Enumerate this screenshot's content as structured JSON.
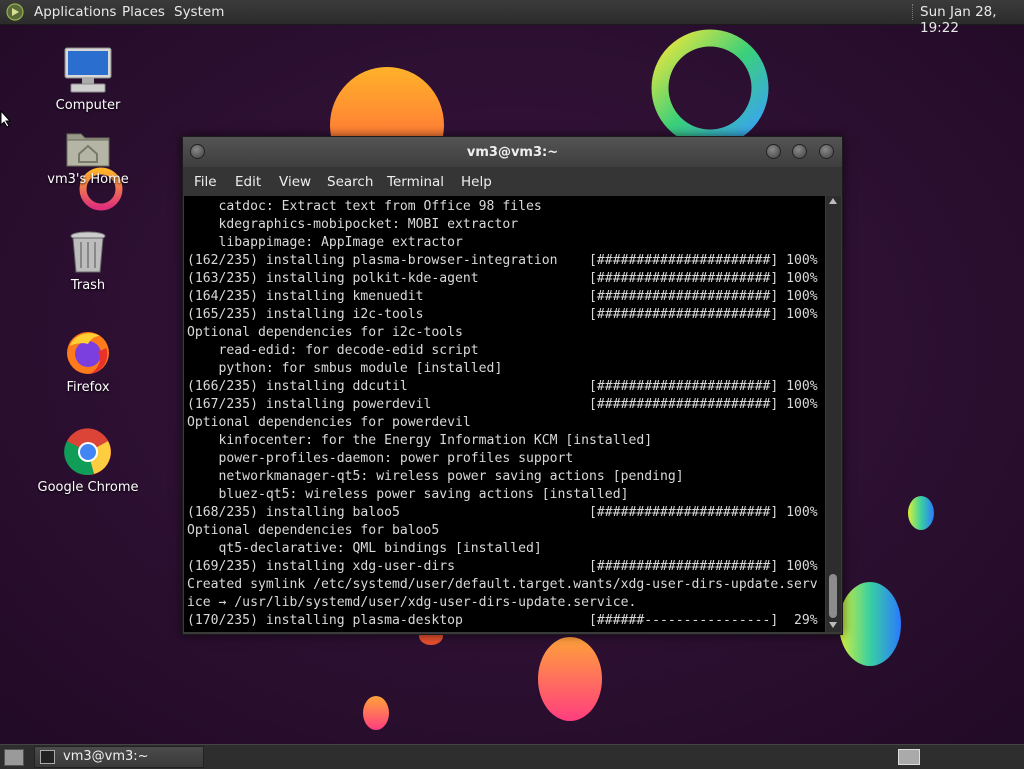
{
  "top_panel": {
    "menus": [
      "Applications",
      "Places",
      "System"
    ],
    "clock": "Sun Jan 28, 19:22"
  },
  "desktop": {
    "icons": [
      {
        "label": "Computer",
        "icon": "computer-icon"
      },
      {
        "label": "vm3's Home",
        "icon": "home-folder-icon"
      },
      {
        "label": "Trash",
        "icon": "trash-icon"
      },
      {
        "label": "Firefox",
        "icon": "firefox-icon"
      },
      {
        "label": "Google Chrome",
        "icon": "chrome-icon"
      }
    ]
  },
  "terminal": {
    "title": "vm3@vm3:~",
    "menus": [
      "File",
      "Edit",
      "View",
      "Search",
      "Terminal",
      "Help"
    ],
    "lines": [
      "    catdoc: Extract text from Office 98 files",
      "    kdegraphics-mobipocket: MOBI extractor",
      "    libappimage: AppImage extractor",
      "(162/235) installing plasma-browser-integration    [######################] 100%",
      "(163/235) installing polkit-kde-agent              [######################] 100%",
      "(164/235) installing kmenuedit                     [######################] 100%",
      "(165/235) installing i2c-tools                     [######################] 100%",
      "Optional dependencies for i2c-tools",
      "    read-edid: for decode-edid script",
      "    python: for smbus module [installed]",
      "(166/235) installing ddcutil                       [######################] 100%",
      "(167/235) installing powerdevil                    [######################] 100%",
      "Optional dependencies for powerdevil",
      "    kinfocenter: for the Energy Information KCM [installed]",
      "    power-profiles-daemon: power profiles support",
      "    networkmanager-qt5: wireless power saving actions [pending]",
      "    bluez-qt5: wireless power saving actions [installed]",
      "(168/235) installing baloo5                        [######################] 100%",
      "Optional dependencies for baloo5",
      "    qt5-declarative: QML bindings [installed]",
      "(169/235) installing xdg-user-dirs                 [######################] 100%",
      "Created symlink /etc/systemd/user/default.target.wants/xdg-user-dirs-update.serv",
      "ice → /usr/lib/systemd/user/xdg-user-dirs-update.service.",
      "(170/235) installing plasma-desktop                [######----------------]  29%"
    ]
  },
  "taskbar": {
    "task_label": "vm3@vm3:~"
  }
}
